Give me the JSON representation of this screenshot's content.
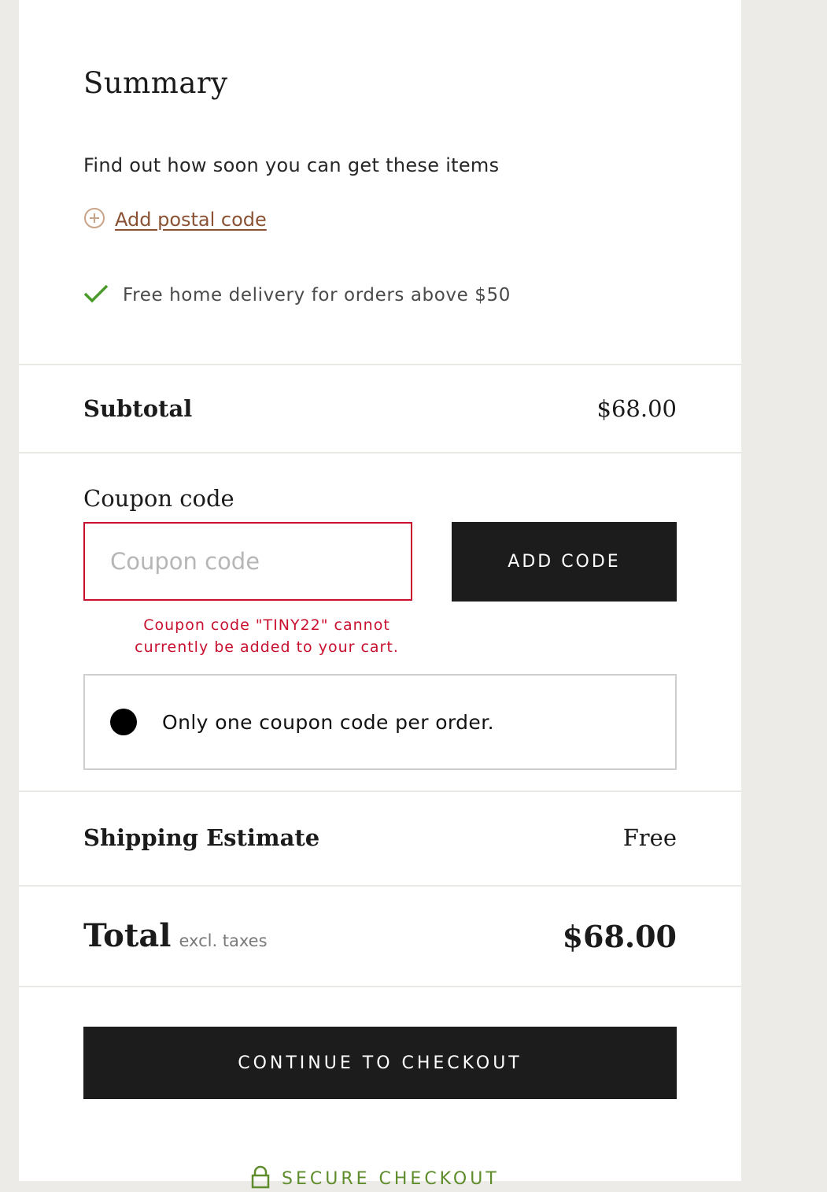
{
  "summary": {
    "title": "Summary",
    "intro": "Find out how soon you can get these items",
    "postal_link": "Add postal code",
    "delivery_note": "Free home delivery for orders above $50"
  },
  "subtotal": {
    "label": "Subtotal",
    "value": "$68.00"
  },
  "coupon": {
    "label": "Coupon code",
    "placeholder": "Coupon code",
    "value": "",
    "button": "ADD CODE",
    "error_line1": "Coupon code \"TINY22\" cannot",
    "error_line2": "currently be added to your cart.",
    "notice": "Only one coupon code per order."
  },
  "shipping": {
    "label": "Shipping Estimate",
    "value": "Free"
  },
  "total": {
    "label": "Total",
    "note": "excl. taxes",
    "value": "$68.00"
  },
  "checkout_button": "CONTINUE TO CHECKOUT",
  "secure_label": "SECURE CHECKOUT",
  "icons": {
    "postal": "plus-circle-icon",
    "delivery": "checkmark-icon",
    "notice": "bullet-icon",
    "secure": "lock-icon"
  },
  "colors": {
    "accent_link": "#8a5233",
    "error": "#c8102e",
    "success": "#4a9a2a",
    "button_dark": "#1c1c1c",
    "secure": "#5f8c2c"
  }
}
